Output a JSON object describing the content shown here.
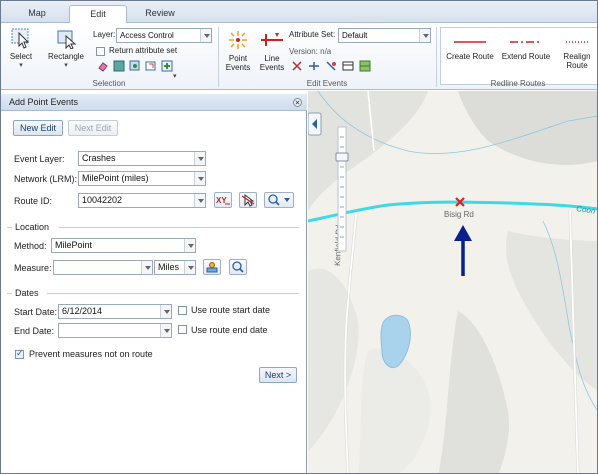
{
  "tabs": {
    "map": "Map",
    "edit": "Edit",
    "review": "Review"
  },
  "ribbon": {
    "select_label": "Select",
    "rectangle_label": "Rectangle",
    "layer_label": "Layer:",
    "layer_value": "Access Control",
    "return_attr_label": "Return attribute set",
    "selection_group": "Selection",
    "point_events_label": "Point Events",
    "line_events_label": "Line Events",
    "attr_set_label": "Attribute Set:",
    "attr_set_value": "Default",
    "version_label": "Version: n/a",
    "edit_events_group": "Edit Events",
    "create_route_label": "Create Route",
    "extend_route_label": "Extend Route",
    "realign_route_label": "Realign Route",
    "redline_group": "Redline Routes"
  },
  "panel": {
    "title": "Add Point Events",
    "new_edit": "New Edit",
    "next_edit": "Next Edit",
    "event_layer_label": "Event Layer:",
    "event_layer_value": "Crashes",
    "network_label": "Network (LRM):",
    "network_value": "MilePoint (miles)",
    "route_id_label": "Route ID:",
    "route_id_value": "10042202",
    "location_section": "Location",
    "method_label": "Method:",
    "method_value": "MilePoint",
    "measure_label": "Measure:",
    "measure_value": "",
    "measure_unit": "Miles",
    "dates_section": "Dates",
    "start_date_label": "Start Date:",
    "start_date_value": "6/12/2014",
    "use_route_start": "Use route start date",
    "end_date_label": "End Date:",
    "end_date_value": "",
    "use_route_end": "Use route end date",
    "prevent_label": "Prevent measures not on route",
    "prevent_checked": true,
    "next_button": "Next >"
  },
  "map": {
    "road_bisig": "Bisig Rd",
    "road_kenfield": "Kenfield Rd",
    "road_coon": "Coon",
    "route_color": "#3fd8e8",
    "marker_color": "#e02020",
    "arrow_color": "#0a1f8c"
  }
}
